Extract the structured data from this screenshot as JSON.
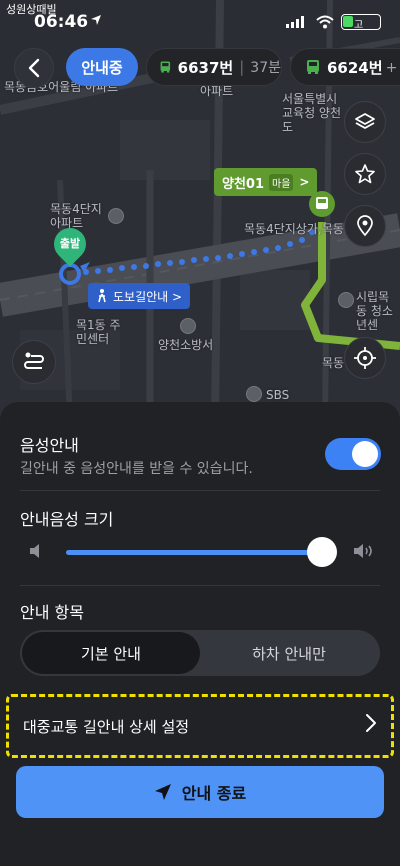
{
  "status": {
    "carrier_back": "성원상때빌",
    "time": "06:46",
    "battery_text": "고"
  },
  "tabs": {
    "active_label": "안내중",
    "bus1": {
      "number": "6637번",
      "time": "37분"
    },
    "bus2": {
      "number": "6624번",
      "suffix": "+ 환"
    }
  },
  "map": {
    "labels": [
      "목동금호어울림 아파트",
      "아파트",
      "서울특별시교육청 양천도",
      "목동4단지 아파트",
      "목동4단지상가,목동",
      "목1동 주민센터",
      "양천소방서",
      "시립목동 청소년센",
      "목동",
      "SBS"
    ],
    "bus_stop": {
      "name": "양천01",
      "type": "마을",
      "chevron": ">"
    },
    "walk_label": "도보길안내 >",
    "start_label": "출발",
    "colors": {
      "bus_route": "#7fb33a",
      "walk_route": "#3c79e6",
      "start": "#2fb57a"
    }
  },
  "sheet": {
    "voice_title": "음성안내",
    "voice_desc": "길안내 중 음성안내를 받을 수 있습니다.",
    "voice_on": true,
    "volume_title": "안내음성 크기",
    "volume_level": 1.0,
    "items_title": "안내 항목",
    "segment": {
      "basic": "기본 안내",
      "alight": "하차 안내만"
    },
    "detail_setting": "대중교통 길안내 상세 설정",
    "end_button": "안내 종료"
  },
  "icons": [
    "back-arrow-icon",
    "bus-icon",
    "layers-icon",
    "star-icon",
    "place-pin-icon",
    "crosshair-icon",
    "route-option-icon",
    "volume-low-icon",
    "volume-high-icon",
    "chevron-right-icon",
    "navigation-arrow-icon",
    "walking-icon"
  ]
}
